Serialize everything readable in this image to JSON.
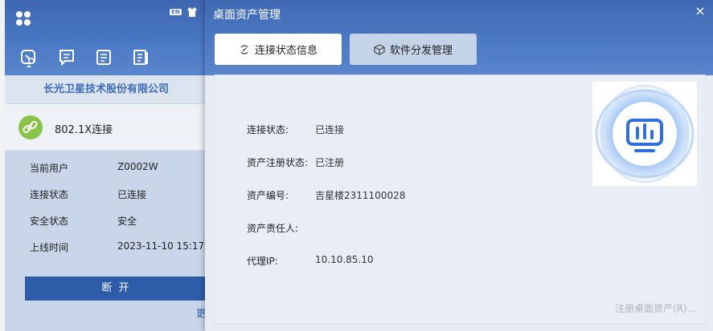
{
  "sidebar_app": {
    "title_badge": "EN",
    "company": "长光卫星技术股份有限公司",
    "connection_type": "802.1X连接",
    "info_rows": [
      {
        "label": "当前用户",
        "value": "Z0002W"
      },
      {
        "label": "连接状态",
        "value": "已连接"
      },
      {
        "label": "安全状态",
        "value": "安全"
      },
      {
        "label": "上线时间",
        "value": "2023-11-10 15:17:"
      }
    ],
    "disconnect_label": "断  开",
    "more_label": "更"
  },
  "dialog": {
    "title": "桌面资产管理",
    "close": "×",
    "tabs": [
      {
        "label": "连接状态信息",
        "active": true
      },
      {
        "label": "软件分发管理",
        "active": false
      }
    ],
    "fields": [
      {
        "label": "连接状态:",
        "value": "已连接"
      },
      {
        "label": "资产注册状态:",
        "value": "已注册"
      },
      {
        "label": "资产编号:",
        "value": "吉星楼2311100028"
      },
      {
        "label": "资产责任人:",
        "value": ""
      },
      {
        "label": "代理IP:",
        "value": "10.10.85.10"
      }
    ],
    "register_link": "注册桌面资产(R)..."
  },
  "colors": {
    "header_blue": "#4a78c3",
    "accent_blue": "#2d5da9",
    "link_green": "#8bc34a"
  }
}
